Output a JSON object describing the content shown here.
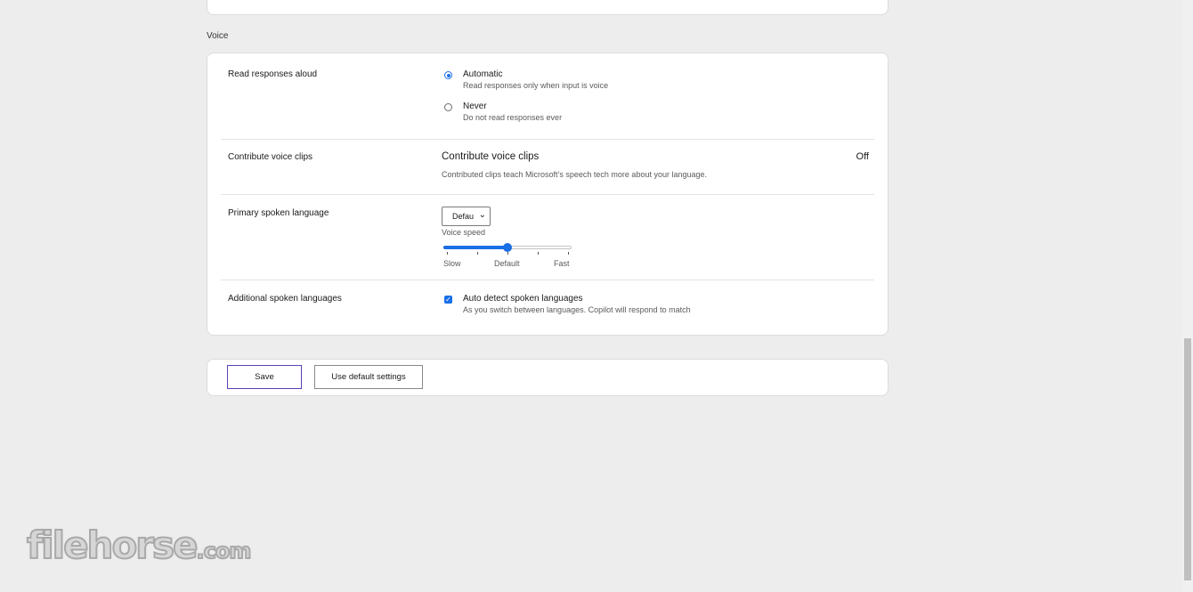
{
  "voice_section": {
    "title": "Voice",
    "read_responses": {
      "label": "Read responses aloud",
      "options": [
        {
          "title": "Automatic",
          "desc": "Read responses only when input is voice",
          "selected": true
        },
        {
          "title": "Never",
          "desc": "Do not read responses ever",
          "selected": false
        }
      ]
    },
    "contribute": {
      "label": "Contribute voice clips",
      "title": "Contribute voice clips",
      "desc": "Contributed clips teach Microsoft’s speech tech more about your language.",
      "state": "Off"
    },
    "primary_language": {
      "label": "Primary spoken language",
      "selected_value": "Default",
      "speed_label": "Voice speed",
      "speed_min_label": "Slow",
      "speed_mid_label": "Default",
      "speed_max_label": "Fast",
      "speed_fraction": 0.5,
      "tick_count": 5
    },
    "additional_languages": {
      "label": "Additional spoken languages",
      "checkbox_title": "Auto detect spoken languages",
      "checkbox_desc": "As you switch between languages. Copilot will respond to match",
      "checked": true
    }
  },
  "actions": {
    "save_label": "Save",
    "default_label": "Use default settings"
  },
  "watermark": {
    "text": "filehorse",
    "suffix": ".com"
  },
  "colors": {
    "accent": "#1a6ee6",
    "save_border": "#5b3fb8",
    "background": "#ededed"
  }
}
